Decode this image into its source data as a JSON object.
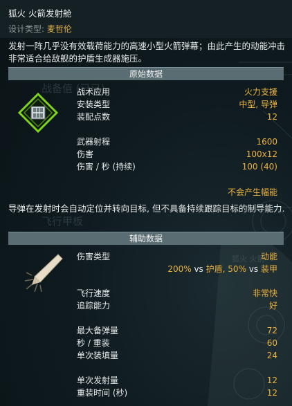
{
  "header": {
    "title": "狐火 火箭发射舱",
    "design_type_label": "设计类型:",
    "design_type_value": "麦哲伦"
  },
  "description": "发射一阵几乎没有效载荷能力的高速小型火箭弹幕；由此产生的动能冲击非常适合给敌舰的护盾生成器施压。",
  "sections": {
    "primary": "原始数据",
    "secondary": "辅助数据"
  },
  "primary_stats": [
    {
      "label": "战术应用",
      "value": "火力支援"
    },
    {
      "label": "安装类型",
      "value": "中型, 导弹"
    },
    {
      "label": "装配点数",
      "value": "12"
    },
    {
      "label": "武器射程",
      "value": "1600"
    },
    {
      "label": "伤害",
      "value": "100x12"
    },
    {
      "label": "伤害 / 秒 (持续)",
      "value": "100 (40)"
    }
  ],
  "flux_note": "不会产生幅能",
  "guidance_note": "导弹在发射时会自动定位并转向目标, 但不具备持续跟踪目标的制导能力.",
  "secondary_stats": {
    "damage_type_label": "伤害类型",
    "damage_type_value": "动能",
    "damage_modifiers": {
      "shield_pct": "200%",
      "vs1": "vs",
      "shield": "护盾,",
      "armor_pct": "50%",
      "vs2": "vs",
      "armor": "装甲"
    },
    "rows": [
      {
        "label": "飞行速度",
        "value": "非常快"
      },
      {
        "label": "追踪能力",
        "value": "好"
      },
      {
        "label": "最大备弹量",
        "value": "72"
      },
      {
        "label": "秒 / 重装",
        "value": "60"
      },
      {
        "label": "单次装填量",
        "value": "24"
      },
      {
        "label": "单次发射量",
        "value": "12"
      },
      {
        "label": "重装时间 (秒)",
        "value": "12"
      }
    ]
  },
  "background_ghost_text": {
    "ops": "战备值 (已已)",
    "flight_deck": "飞行甲板",
    "weapon_name": "狐火 火箭"
  },
  "icons": {
    "mount_icon": "medium-missile-mount-icon",
    "damage_icon": "kinetic-damage-icon"
  },
  "colors": {
    "accent": "#ecb33f",
    "text": "#e9ecec",
    "section_bar": "#5a6d73",
    "mount_green": "#7ed321"
  }
}
